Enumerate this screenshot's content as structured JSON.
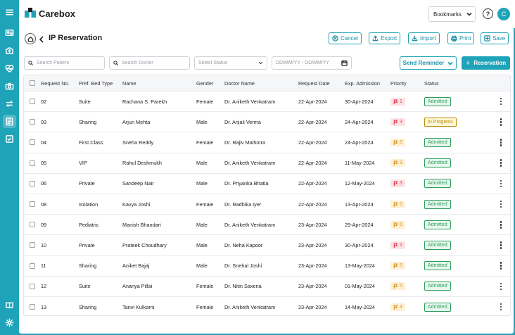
{
  "app": {
    "name": "Carebox",
    "bookmarks_label": "Bookmarks",
    "help_label": "?",
    "avatar_initial": "C"
  },
  "rail_icons": [
    "menu-icon",
    "id-card-icon",
    "hospital-icon",
    "heart-pulse-icon",
    "camera-icon",
    "transfer-icon",
    "clipboard-icon",
    "checklist-icon",
    "user-guide-icon",
    "settings-icon"
  ],
  "header": {
    "title": "IP Reservation",
    "actions": {
      "cancel": "Cancel",
      "export": "Export",
      "import": "Import",
      "print": "Print",
      "save": "Save"
    }
  },
  "filters": {
    "patient_placeholder": "Search Patient",
    "doctor_placeholder": "Search Doctor",
    "status_placeholder": "Select Status",
    "date_placeholder": "DD/MM/YY - DD/MM/YY",
    "send_reminder": "Send Reminder",
    "add_reservation": "Reservation"
  },
  "table": {
    "columns": [
      "Request No.",
      "Pref. Bed Type",
      "Name",
      "Gender",
      "Doctor Name",
      "Request Date",
      "Exp. Admission",
      "Priority",
      "Status"
    ],
    "rows": [
      {
        "req": "02",
        "bed": "Suite",
        "name": "Rachana S. Parekh",
        "gender": "Female",
        "doctor": "Dr. Aniketh Venkatram",
        "req_date": "22-Apr-2024",
        "adm": "30-Apr-2024",
        "priority": "1",
        "status": "Admitted"
      },
      {
        "req": "03",
        "bed": "Sharing",
        "name": "Arjun Mehta",
        "gender": "Male",
        "doctor": "Dr. Anjali Verma",
        "req_date": "22-Apr-2024",
        "adm": "24-Apr-2024",
        "priority": "3",
        "status": "In Progress"
      },
      {
        "req": "04",
        "bed": "First Class",
        "name": "Sneha Reddy",
        "gender": "Female",
        "doctor": "Dr. Rajiv Malhotra",
        "req_date": "22-Apr-2024",
        "adm": "24-Apr-2024",
        "priority": "6",
        "status": "Admitted"
      },
      {
        "req": "05",
        "bed": "VIP",
        "name": "Rahul Deshmukh",
        "gender": "Male",
        "doctor": "Dr. Aniketh Venkatram",
        "req_date": "22-Apr-2024",
        "adm": "11-May-2024",
        "priority": "9",
        "status": "Admitted"
      },
      {
        "req": "06",
        "bed": "Private",
        "name": "Sandeep Nair",
        "gender": "Male",
        "doctor": "Dr. Priyanka Bhatia",
        "req_date": "22-Apr-2024",
        "adm": "12-May-2024",
        "priority": "3",
        "status": "Admitted"
      },
      {
        "req": "08",
        "bed": "Isolation",
        "name": "Kavya Joshi",
        "gender": "Female",
        "doctor": "Dr. Radhika Iyer",
        "req_date": "22-Apr-2024",
        "adm": "13-Apr-2024",
        "priority": "5",
        "status": "Admitted"
      },
      {
        "req": "09",
        "bed": "Pediatric",
        "name": "Manish Bhandari",
        "gender": "Male",
        "doctor": "Dr. Aniketh Venkatram",
        "req_date": "23-Apr-2024",
        "adm": "29-Apr-2024",
        "priority": "6",
        "status": "Admitted"
      },
      {
        "req": "10",
        "bed": "Private",
        "name": "Prateek Choudhary",
        "gender": "Male",
        "doctor": "Dr. Neha Kapoor",
        "req_date": "23-Apr-2024",
        "adm": "30-Apr-2024",
        "priority": "2",
        "status": "Admitted"
      },
      {
        "req": "11",
        "bed": "Sharing",
        "name": "Aniket Bajaj",
        "gender": "Male",
        "doctor": "Dr. Snehal Joshi",
        "req_date": "23-Apr-2024",
        "adm": "13-May-2024",
        "priority": "5",
        "status": "Admitted"
      },
      {
        "req": "12",
        "bed": "Suite",
        "name": "Ananya Pillai",
        "gender": "Female",
        "doctor": "Dr. Nitin Saxena",
        "req_date": "23-Apr-2024",
        "adm": "01-May-2024",
        "priority": "5",
        "status": "Admitted"
      },
      {
        "req": "13",
        "bed": "Sharing",
        "name": "Tanvi Kulkarni",
        "gender": "Female",
        "doctor": "Dr. Aniketh Venkatram",
        "req_date": "23-Apr-2024",
        "adm": "14-May-2024",
        "priority": "4",
        "status": "Admitted"
      }
    ]
  },
  "colors": {
    "brand": "#1fa3b8",
    "priority_high_bg": "#fde2e4",
    "priority_high_fg": "#d9475a",
    "priority_mid_bg": "#fdf0d5",
    "priority_mid_fg": "#d99a2b",
    "status_admitted_bg": "#e8f7ee",
    "status_admitted_fg": "#2e9e5b",
    "status_progress_bg": "#fff8d6",
    "status_progress_fg": "#b98900"
  }
}
